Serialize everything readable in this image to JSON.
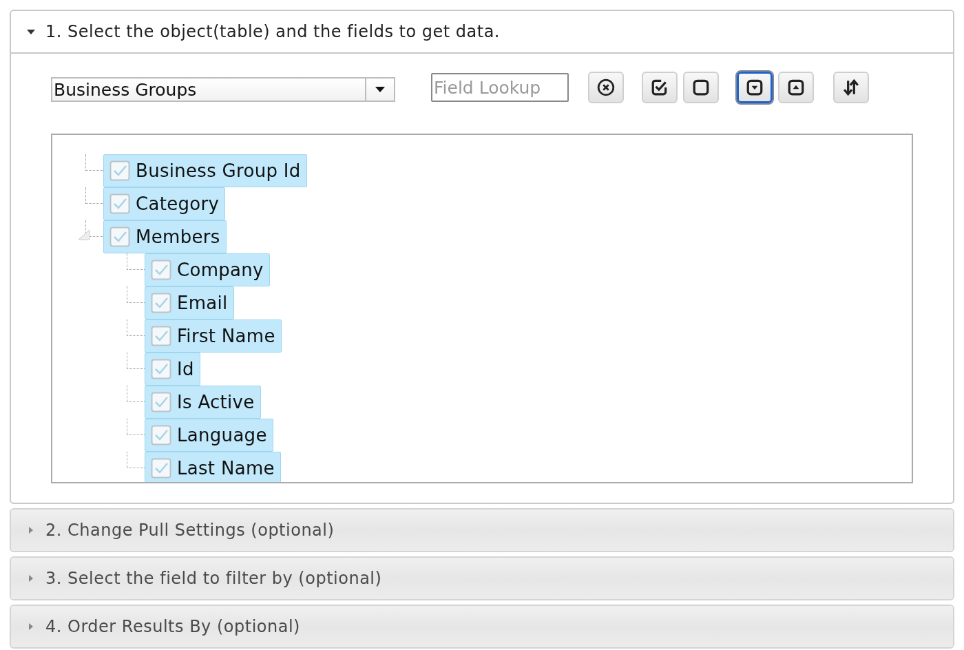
{
  "sections": [
    {
      "title": "1. Select the object(table) and the fields to get data.",
      "expanded": true
    },
    {
      "title": "2. Change Pull Settings (optional)",
      "expanded": false
    },
    {
      "title": "3. Select the field to filter by (optional)",
      "expanded": false
    },
    {
      "title": "4. Order Results By (optional)",
      "expanded": false
    }
  ],
  "object_select": {
    "value": "Business Groups"
  },
  "field_lookup": {
    "placeholder": "Field Lookup"
  },
  "toolbar": [
    {
      "kind": "clear",
      "selected": false
    },
    {
      "kind": "check-all",
      "selected": false
    },
    {
      "kind": "uncheck-all",
      "selected": false
    },
    {
      "kind": "expand-all",
      "selected": true
    },
    {
      "kind": "collapse-all",
      "selected": false
    },
    {
      "kind": "sort",
      "selected": false
    }
  ],
  "tree": [
    {
      "label": "Business Group Id",
      "checked": true
    },
    {
      "label": "Category",
      "checked": true
    },
    {
      "label": "Members",
      "checked": true,
      "expanded": true,
      "children": [
        {
          "label": "Company",
          "checked": true
        },
        {
          "label": "Email",
          "checked": true
        },
        {
          "label": "First Name",
          "checked": true
        },
        {
          "label": "Id",
          "checked": true
        },
        {
          "label": "Is Active",
          "checked": true
        },
        {
          "label": "Language",
          "checked": true
        },
        {
          "label": "Last Name",
          "checked": true
        }
      ]
    }
  ]
}
